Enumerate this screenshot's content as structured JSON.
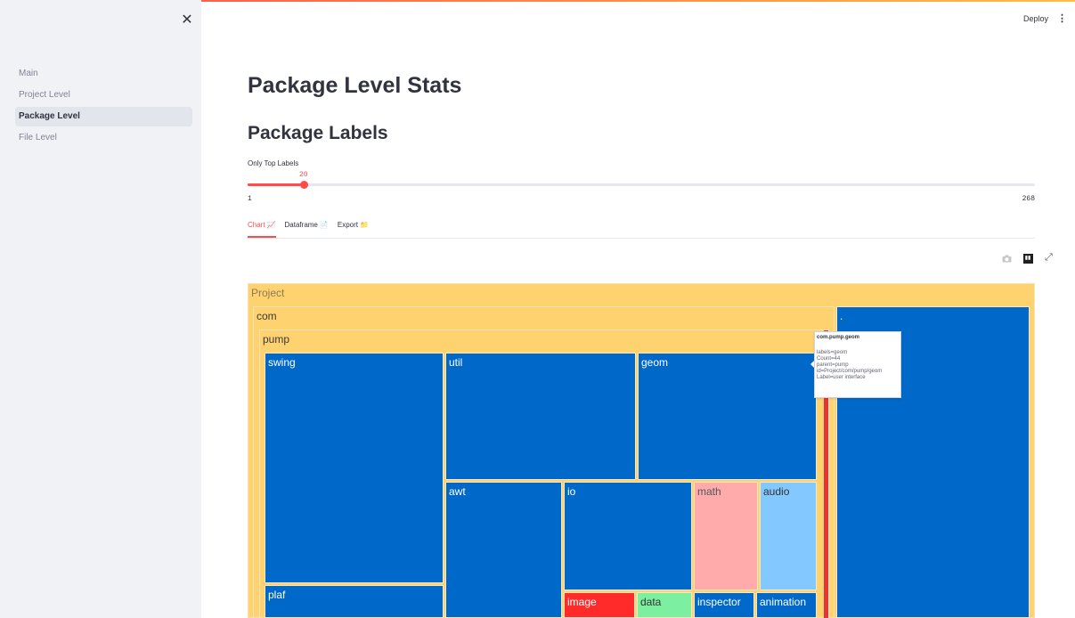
{
  "app": {
    "deploy_label": "Deploy",
    "close_symbol": "✕",
    "menu_symbol": "⋮"
  },
  "sidebar": {
    "items": [
      {
        "label": "Main",
        "active": false
      },
      {
        "label": "Project Level",
        "active": false
      },
      {
        "label": "Package Level",
        "active": true
      },
      {
        "label": "File Level",
        "active": false
      }
    ]
  },
  "main": {
    "title": "Package Level Stats",
    "subtitle": "Package Labels",
    "slider": {
      "label": "Only Top Labels",
      "value": "20",
      "min": "1",
      "max": "268",
      "fraction": 0.0712
    },
    "tabs": [
      {
        "label": "Chart",
        "emoji": "📈",
        "active": true
      },
      {
        "label": "Dataframe",
        "emoji": "📄",
        "active": false
      },
      {
        "label": "Export",
        "emoji": "📁",
        "active": false
      }
    ]
  },
  "colors": {
    "accent": "#ff4b4b",
    "treemap_parent": "#ffd270",
    "treemap_blue": "#0068c9",
    "treemap_lightblue": "#83c9ff",
    "treemap_pink": "#ffabab",
    "treemap_red": "#ff2b2b",
    "treemap_green": "#7defa1"
  },
  "treemap": {
    "labels": [
      "Project",
      "com",
      "pump",
      ".",
      "swing",
      "util",
      "geom",
      "awt",
      "io",
      "math",
      "audio",
      "plaf",
      "image",
      "data",
      "inspector",
      "animation"
    ]
  },
  "tooltip": {
    "title": "com.pump.geom",
    "lines": [
      "labels=geom",
      "Count=44",
      "parent=pump",
      "id=Project/com/pump/geom",
      "Label=user interface"
    ]
  }
}
